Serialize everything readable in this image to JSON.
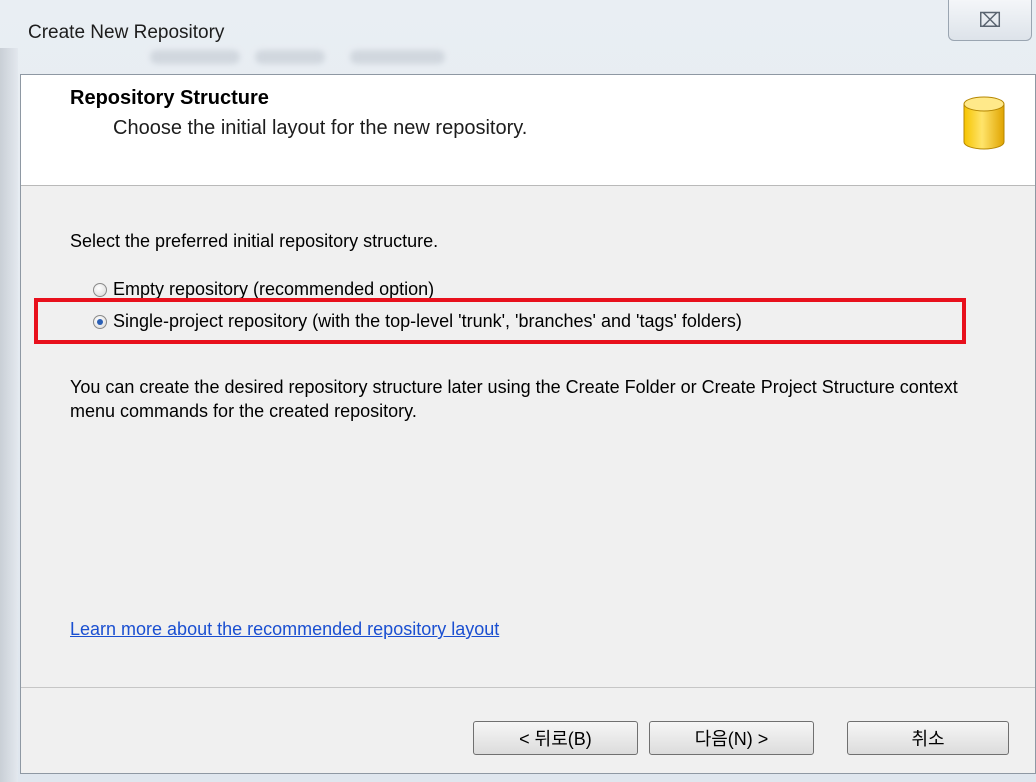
{
  "window": {
    "title": "Create New Repository",
    "close_glyph": "⌧"
  },
  "header": {
    "title": "Repository Structure",
    "subtitle": "Choose the initial layout for the new repository."
  },
  "content": {
    "prompt": "Select the preferred initial repository structure.",
    "options": [
      {
        "label": "Empty repository (recommended option)",
        "selected": false
      },
      {
        "label": "Single-project repository (with the top-level 'trunk', 'branches' and 'tags' folders)",
        "selected": true
      }
    ],
    "note": "You can create the desired repository structure later using the Create Folder or Create Project Structure context menu commands for the created repository.",
    "link": "Learn more about the recommended repository layout"
  },
  "buttons": {
    "back": "< 뒤로(B)",
    "next": "다음(N) >",
    "cancel": "취소"
  },
  "colors": {
    "highlight": "#e8101c",
    "link": "#1a4fd1",
    "icon": "#f0b400"
  }
}
